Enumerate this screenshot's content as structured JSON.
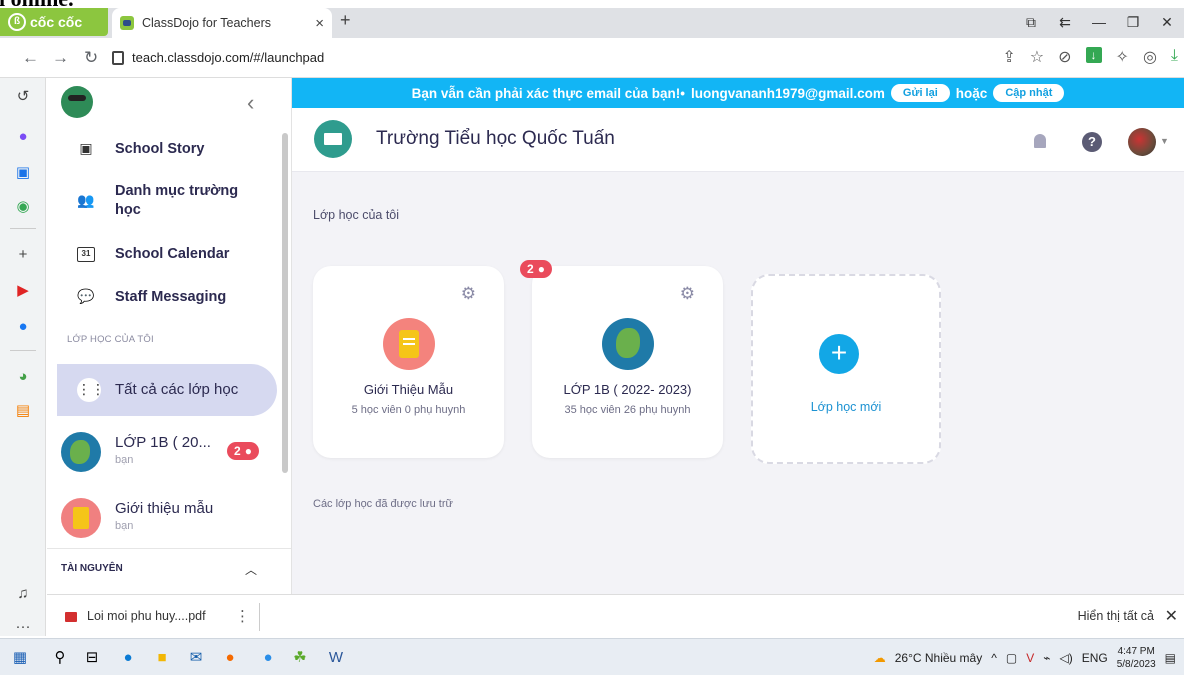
{
  "top_strip_text": "ı online.",
  "browser": {
    "brand": "cốc cốc",
    "tab_title": "ClassDojo for Teachers",
    "new_tab": "+",
    "url": "teach.classdojo.com/#/launchpad"
  },
  "sidebar": {
    "items": [
      {
        "label": "School Story"
      },
      {
        "label": "Danh mục trường học"
      },
      {
        "label": "School Calendar",
        "icon_text": "31"
      },
      {
        "label": "Staff Messaging"
      }
    ],
    "section_my_classes": "LỚP HỌC CỦA TÔI",
    "all_classes": "Tất cả các lớp học",
    "classes": [
      {
        "name": "LỚP 1B ( 20...",
        "role": "bạn",
        "badge": "2"
      },
      {
        "name": "Giới thiệu mẫu",
        "role": "bạn"
      }
    ],
    "resources": "TÀI NGUYÊN"
  },
  "banner": {
    "text": "Bạn vẫn cần phải xác thực email của bạn!•",
    "email": "luongvananh1979@gmail.com",
    "resend": "Gửi lại",
    "or": "hoặc",
    "update": "Cập nhật"
  },
  "header": {
    "school_name": "Trường Tiểu học Quốc Tuấn"
  },
  "main": {
    "my_classes_title": "Lớp học của tôi",
    "cards": [
      {
        "name": "Giới Thiệu Mẫu",
        "info": "5 học viên 0 phụ huynh"
      },
      {
        "name": "LỚP 1B ( 2022- 2023)",
        "info": "35 học viên 26 phụ huynh",
        "badge": "2"
      }
    ],
    "new_class": "Lớp học mới",
    "archived_title": "Các lớp học đã được lưu trữ"
  },
  "downloads": {
    "file": "Loi moi phu huy....pdf",
    "show_all": "Hiển thị tất cả"
  },
  "taskbar": {
    "weather": "26°C  Nhiều mây",
    "lang": "ENG",
    "time": "4:47 PM",
    "date": "5/8/2023"
  }
}
